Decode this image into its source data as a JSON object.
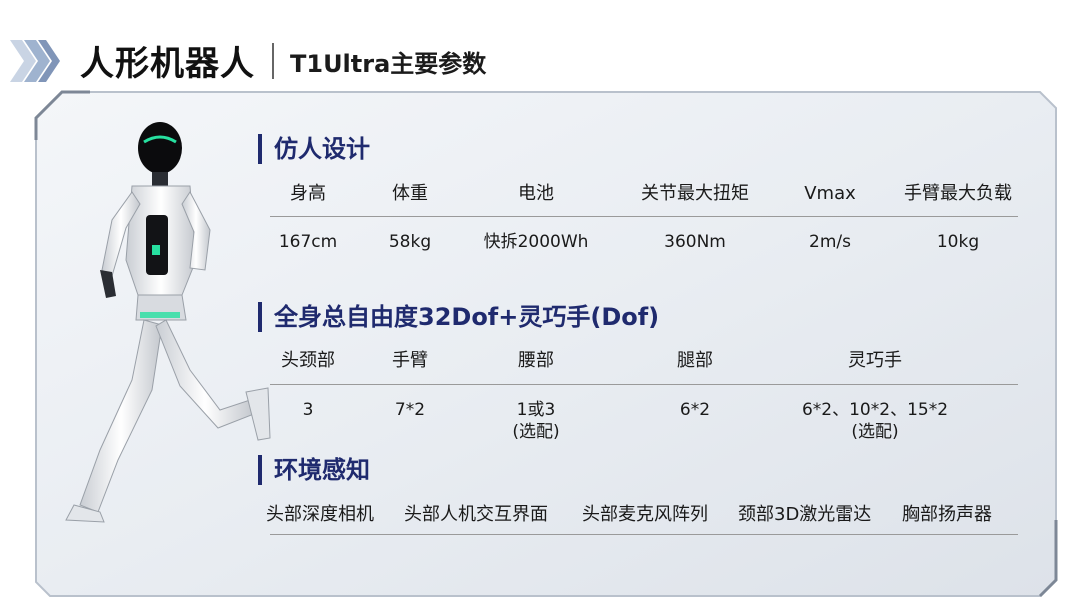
{
  "header": {
    "title": "人形机器人",
    "subtitle": "T1Ultra主要参数"
  },
  "colors": {
    "accent_navy": "#1f2a6e",
    "chevron_blue": "#8fa8c8",
    "robot_accent_green": "#27e0a0"
  },
  "sections": {
    "design": {
      "heading": "仿人设计",
      "headers": [
        "身高",
        "体重",
        "电池",
        "关节最大扭矩",
        "Vmax",
        "手臂最大负载"
      ],
      "values": [
        "167cm",
        "58kg",
        "快拆2000Wh",
        "360Nm",
        "2m/s",
        "10kg"
      ]
    },
    "dof": {
      "heading": "全身总自由度32Dof+灵巧手(Dof)",
      "headers": [
        "头颈部",
        "手臂",
        "腰部",
        "腿部",
        "灵巧手"
      ],
      "values": [
        {
          "line1": "3",
          "line2": ""
        },
        {
          "line1": "7*2",
          "line2": ""
        },
        {
          "line1": "1或3",
          "line2": "(选配)"
        },
        {
          "line1": "6*2",
          "line2": ""
        },
        {
          "line1": "6*2、10*2、15*2",
          "line2": "(选配)"
        }
      ]
    },
    "perception": {
      "heading": "环境感知",
      "items": [
        "头部深度相机",
        "头部人机交互界面",
        "头部麦克风阵列",
        "颈部3D激光雷达",
        "胸部扬声器"
      ]
    }
  }
}
